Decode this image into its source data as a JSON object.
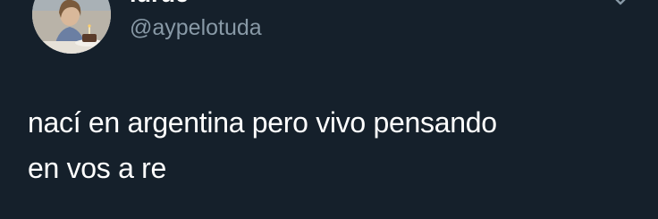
{
  "tweet": {
    "author": {
      "display_name": "lurue",
      "handle": "@aypelotuda"
    },
    "text_lines": [
      "nací en argentina pero vivo pensando",
      "en vos a re"
    ]
  },
  "icons": {
    "more": "chevron-down-icon",
    "avatar": "avatar"
  },
  "colors": {
    "background": "#15202b",
    "text": "#ffffff",
    "secondary": "#8899a6"
  }
}
